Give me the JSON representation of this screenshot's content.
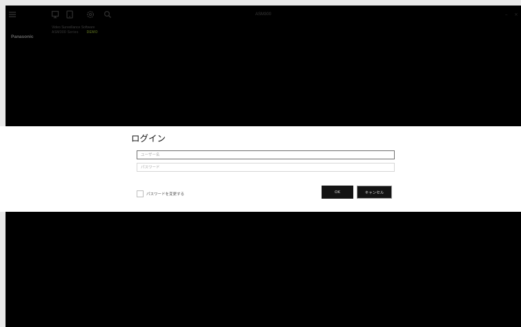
{
  "app": {
    "title": "ASM300",
    "brand": "Panasonic",
    "product_line1": "Video Surveillance Software",
    "product_line2": "ASM300 Series",
    "edition_badge": "DEMO"
  },
  "toolbar": {
    "icons": [
      "menu-icon",
      "monitor-icon",
      "tablet-icon",
      "gear-icon",
      "search-icon"
    ]
  },
  "window_controls": {
    "minimize": "–",
    "close": "×"
  },
  "login_dialog": {
    "title": "ログイン",
    "username_placeholder": "ユーザー名",
    "password_placeholder": "パスワード",
    "change_password_label": "パスワードを変更する",
    "ok_label": "OK",
    "cancel_label": "キャンセル"
  }
}
